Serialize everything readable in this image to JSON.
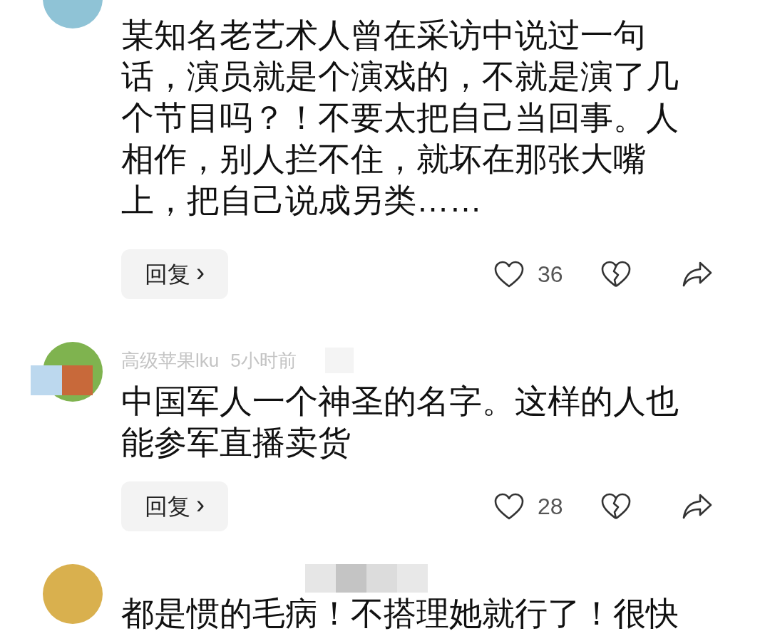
{
  "comments": [
    {
      "color": "#8fc3d6",
      "text": "某知名老艺术人曾在采访中说过一句话，演员就是个演戏的，不就是演了几个节目吗？！不要太把自己当回事。人相作，别人拦不住，就坏在那张大嘴上，把自己说成另类……",
      "reply_label": "回复",
      "reply_arrow": "›",
      "likes": "36"
    },
    {
      "color": "#7fb34f",
      "author": "高级苹果lku",
      "time": "5小时前",
      "text": "中国军人一个神圣的名字。这样的人也能参军直播卖货",
      "reply_label": "回复",
      "reply_arrow": "›",
      "likes": "28"
    },
    {
      "color": "#d9b04e",
      "text": "都是惯的毛病！不搭理她就行了！很快"
    }
  ]
}
